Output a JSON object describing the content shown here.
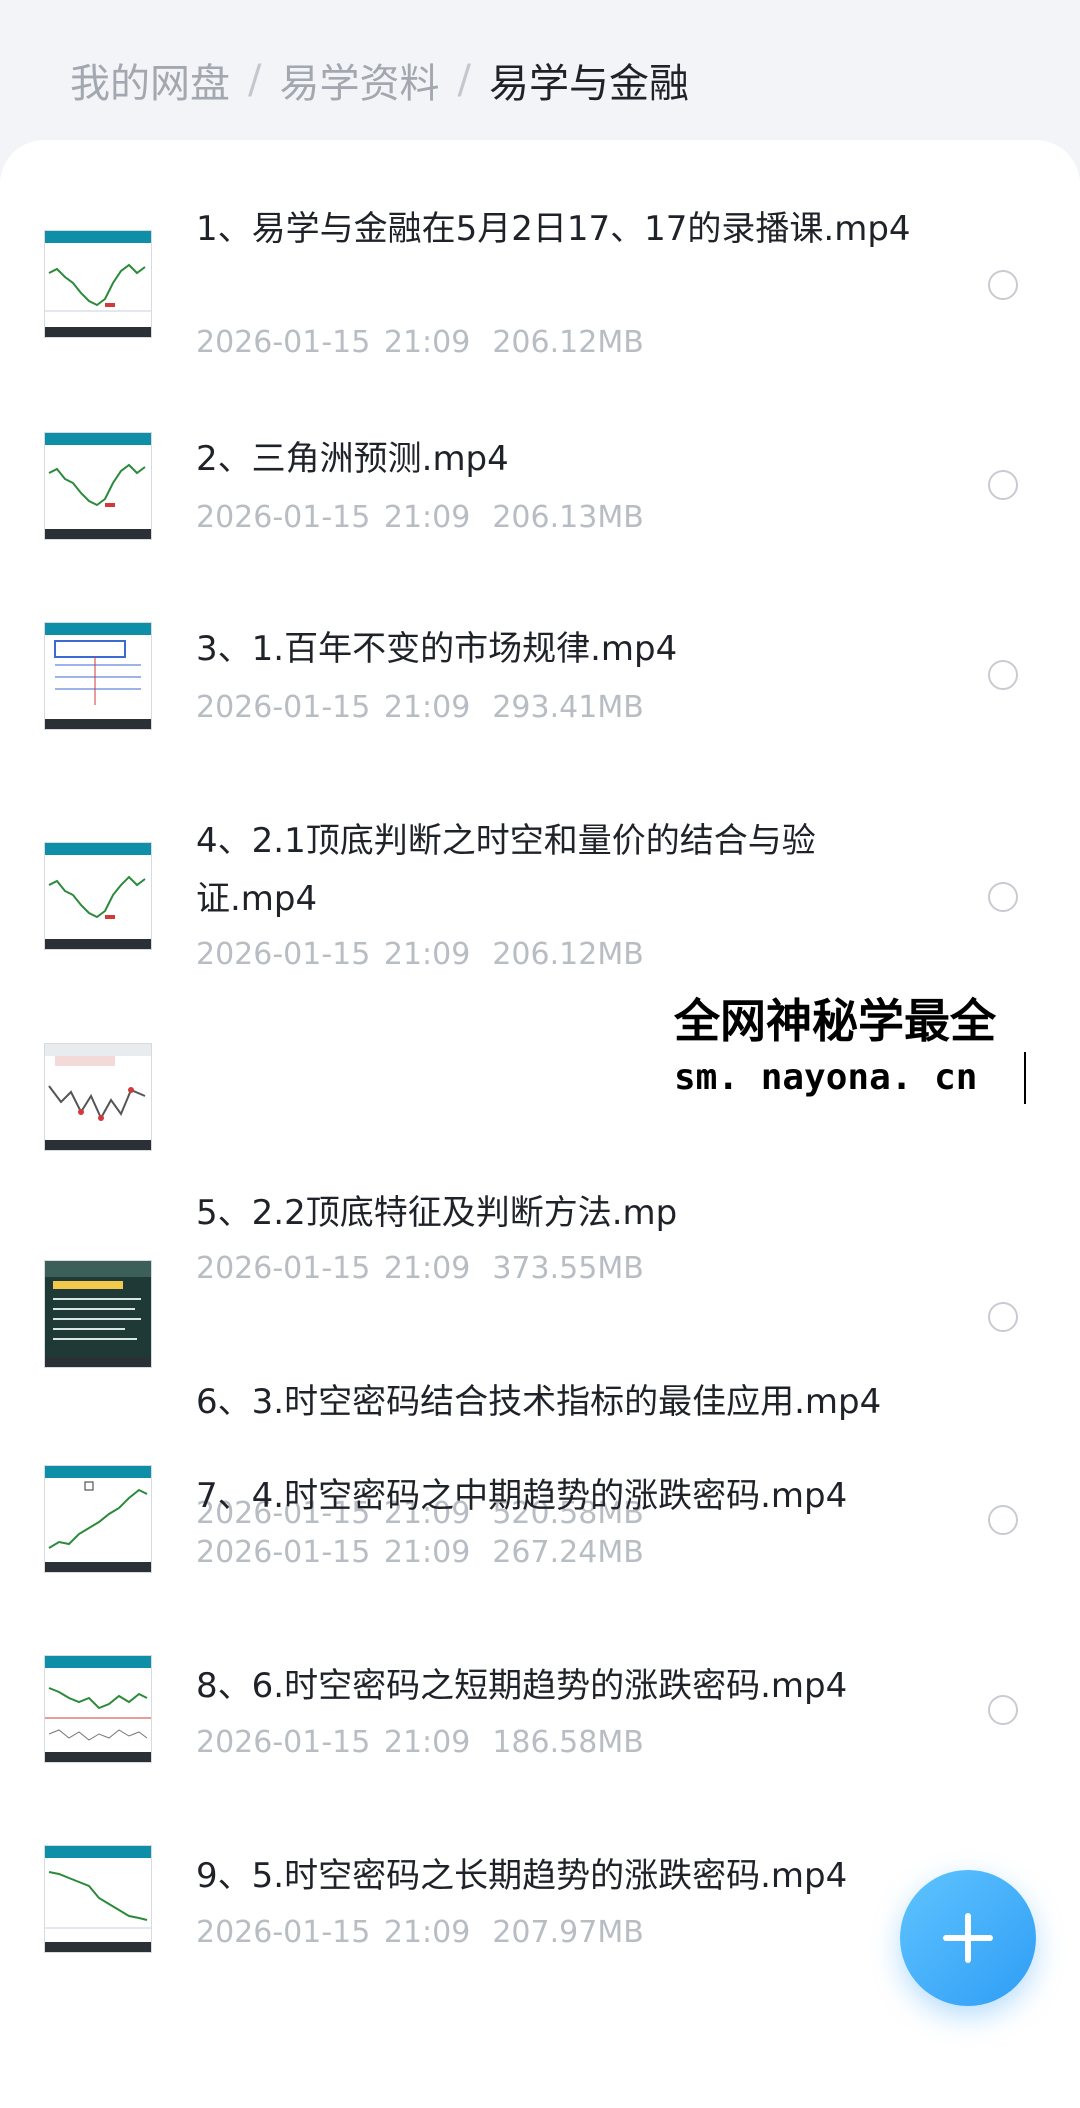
{
  "breadcrumb": {
    "items": [
      "我的网盘",
      "易学资料",
      "易学与金融"
    ],
    "separator": "/"
  },
  "files": [
    {
      "name": "1、易学与金融在5月2日17、17的录播课.mp4",
      "date": "2026-01-15 21:09",
      "size": "206.12MB",
      "thumb_icon": "chart-video-thumbnail"
    },
    {
      "name": "2、三角洲预测.mp4",
      "date": "2026-01-15 21:09",
      "size": "206.13MB",
      "thumb_icon": "chart-video-thumbnail"
    },
    {
      "name": "3、1.百年不变的市场规律.mp4",
      "date": "2026-01-15 21:09",
      "size": "293.41MB",
      "thumb_icon": "diagram-video-thumbnail"
    },
    {
      "name": "4、2.1顶底判断之时空和量价的结合与验证.mp4",
      "date": "2026-01-15 21:09",
      "size": "206.12MB",
      "thumb_icon": "chart-video-thumbnail"
    },
    {
      "name": "5、2.2顶底特征及判断方法.mp4",
      "date": "2026-01-15 21:09",
      "size": "373.55MB",
      "thumb_icon": "zigzag-video-thumbnail"
    },
    {
      "name": "6、3.时空密码结合技术指标的最佳应用.mp4",
      "date": "2026-01-15 21:09",
      "size": "520.58MB",
      "thumb_icon": "slide-video-thumbnail"
    },
    {
      "name": "7、4.时空密码之中期趋势的涨跌密码.mp4",
      "date": "2026-01-15 21:09",
      "size": "267.24MB",
      "thumb_icon": "chart-video-thumbnail"
    },
    {
      "name": "8、6.时空密码之短期趋势的涨跌密码.mp4",
      "date": "2026-01-15 21:09",
      "size": "186.58MB",
      "thumb_icon": "chart-video-thumbnail"
    },
    {
      "name": "9、5.时空密码之长期趋势的涨跌密码.mp4",
      "date": "2026-01-15 21:09",
      "size": "207.97MB",
      "thumb_icon": "chart-video-thumbnail"
    }
  ],
  "watermark": {
    "line1": "全网神秘学最全",
    "line2": "sm. nayona. cn"
  },
  "fab": {
    "icon": "plus-icon"
  },
  "colors": {
    "accent": "#2f9df5",
    "meta": "#b8bdc4",
    "breadcrumb_inactive": "#a3a8b0"
  }
}
